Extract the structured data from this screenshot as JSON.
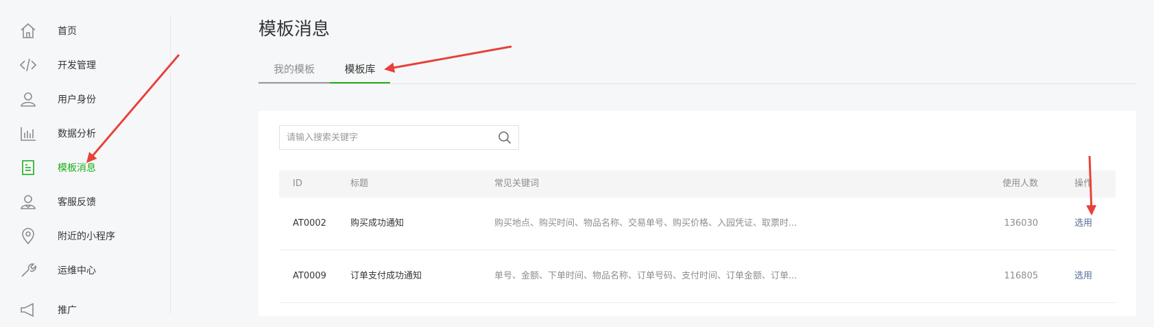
{
  "sidebar": {
    "items": [
      {
        "label": "首页",
        "icon": "home-icon"
      },
      {
        "label": "开发管理",
        "icon": "code-icon"
      },
      {
        "label": "用户身份",
        "icon": "user-icon"
      },
      {
        "label": "数据分析",
        "icon": "bar-chart-icon"
      },
      {
        "label": "模板消息",
        "icon": "document-icon",
        "active": true
      },
      {
        "label": "客服反馈",
        "icon": "customer-service-icon"
      },
      {
        "label": "附近的小程序",
        "icon": "location-pin-icon"
      },
      {
        "label": "运维中心",
        "icon": "wrench-icon"
      },
      {
        "label": "推广",
        "icon": "megaphone-icon"
      }
    ],
    "active_color": "#1aad19"
  },
  "main": {
    "title": "模板消息",
    "tabs": [
      {
        "label": "我的模板"
      },
      {
        "label": "模板库",
        "active": true
      }
    ],
    "search": {
      "placeholder": "请输入搜索关键字",
      "value": ""
    },
    "table": {
      "columns": [
        "ID",
        "标题",
        "常见关键词",
        "使用人数",
        "操作"
      ],
      "rows": [
        {
          "id": "AT0002",
          "title": "购买成功通知",
          "keywords": "购买地点、购买时间、物品名称、交易单号、购买价格、入园凭证、取票时...",
          "users": "136030",
          "action": "选用"
        },
        {
          "id": "AT0009",
          "title": "订单支付成功通知",
          "keywords": "单号、金额、下单时间、物品名称、订单号码、支付时间、订单金额、订单...",
          "users": "116805",
          "action": "选用"
        }
      ]
    },
    "link_color": "#576b95"
  },
  "annotations": {
    "arrow_color": "#e8403a"
  }
}
